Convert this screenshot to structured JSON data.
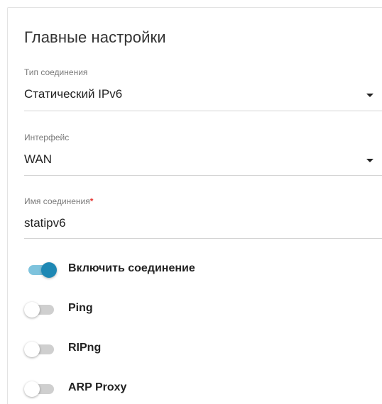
{
  "section": {
    "title": "Главные настройки"
  },
  "fields": {
    "connection_type": {
      "label": "Тип соединения",
      "value": "Статический IPv6"
    },
    "interface": {
      "label": "Интерфейс",
      "value": "WAN"
    },
    "connection_name": {
      "label": "Имя соединения",
      "required_mark": "*",
      "value": "statipv6"
    }
  },
  "toggles": {
    "enable_connection": {
      "label": "Включить соединение",
      "on": true
    },
    "ping": {
      "label": "Ping",
      "on": false
    },
    "ripng": {
      "label": "RIPng",
      "on": false
    },
    "arp_proxy": {
      "label": "ARP Proxy",
      "on": false
    }
  },
  "colors": {
    "accent": "#1e88b4",
    "accent_track": "#7ec3dd",
    "required": "#e53935"
  }
}
